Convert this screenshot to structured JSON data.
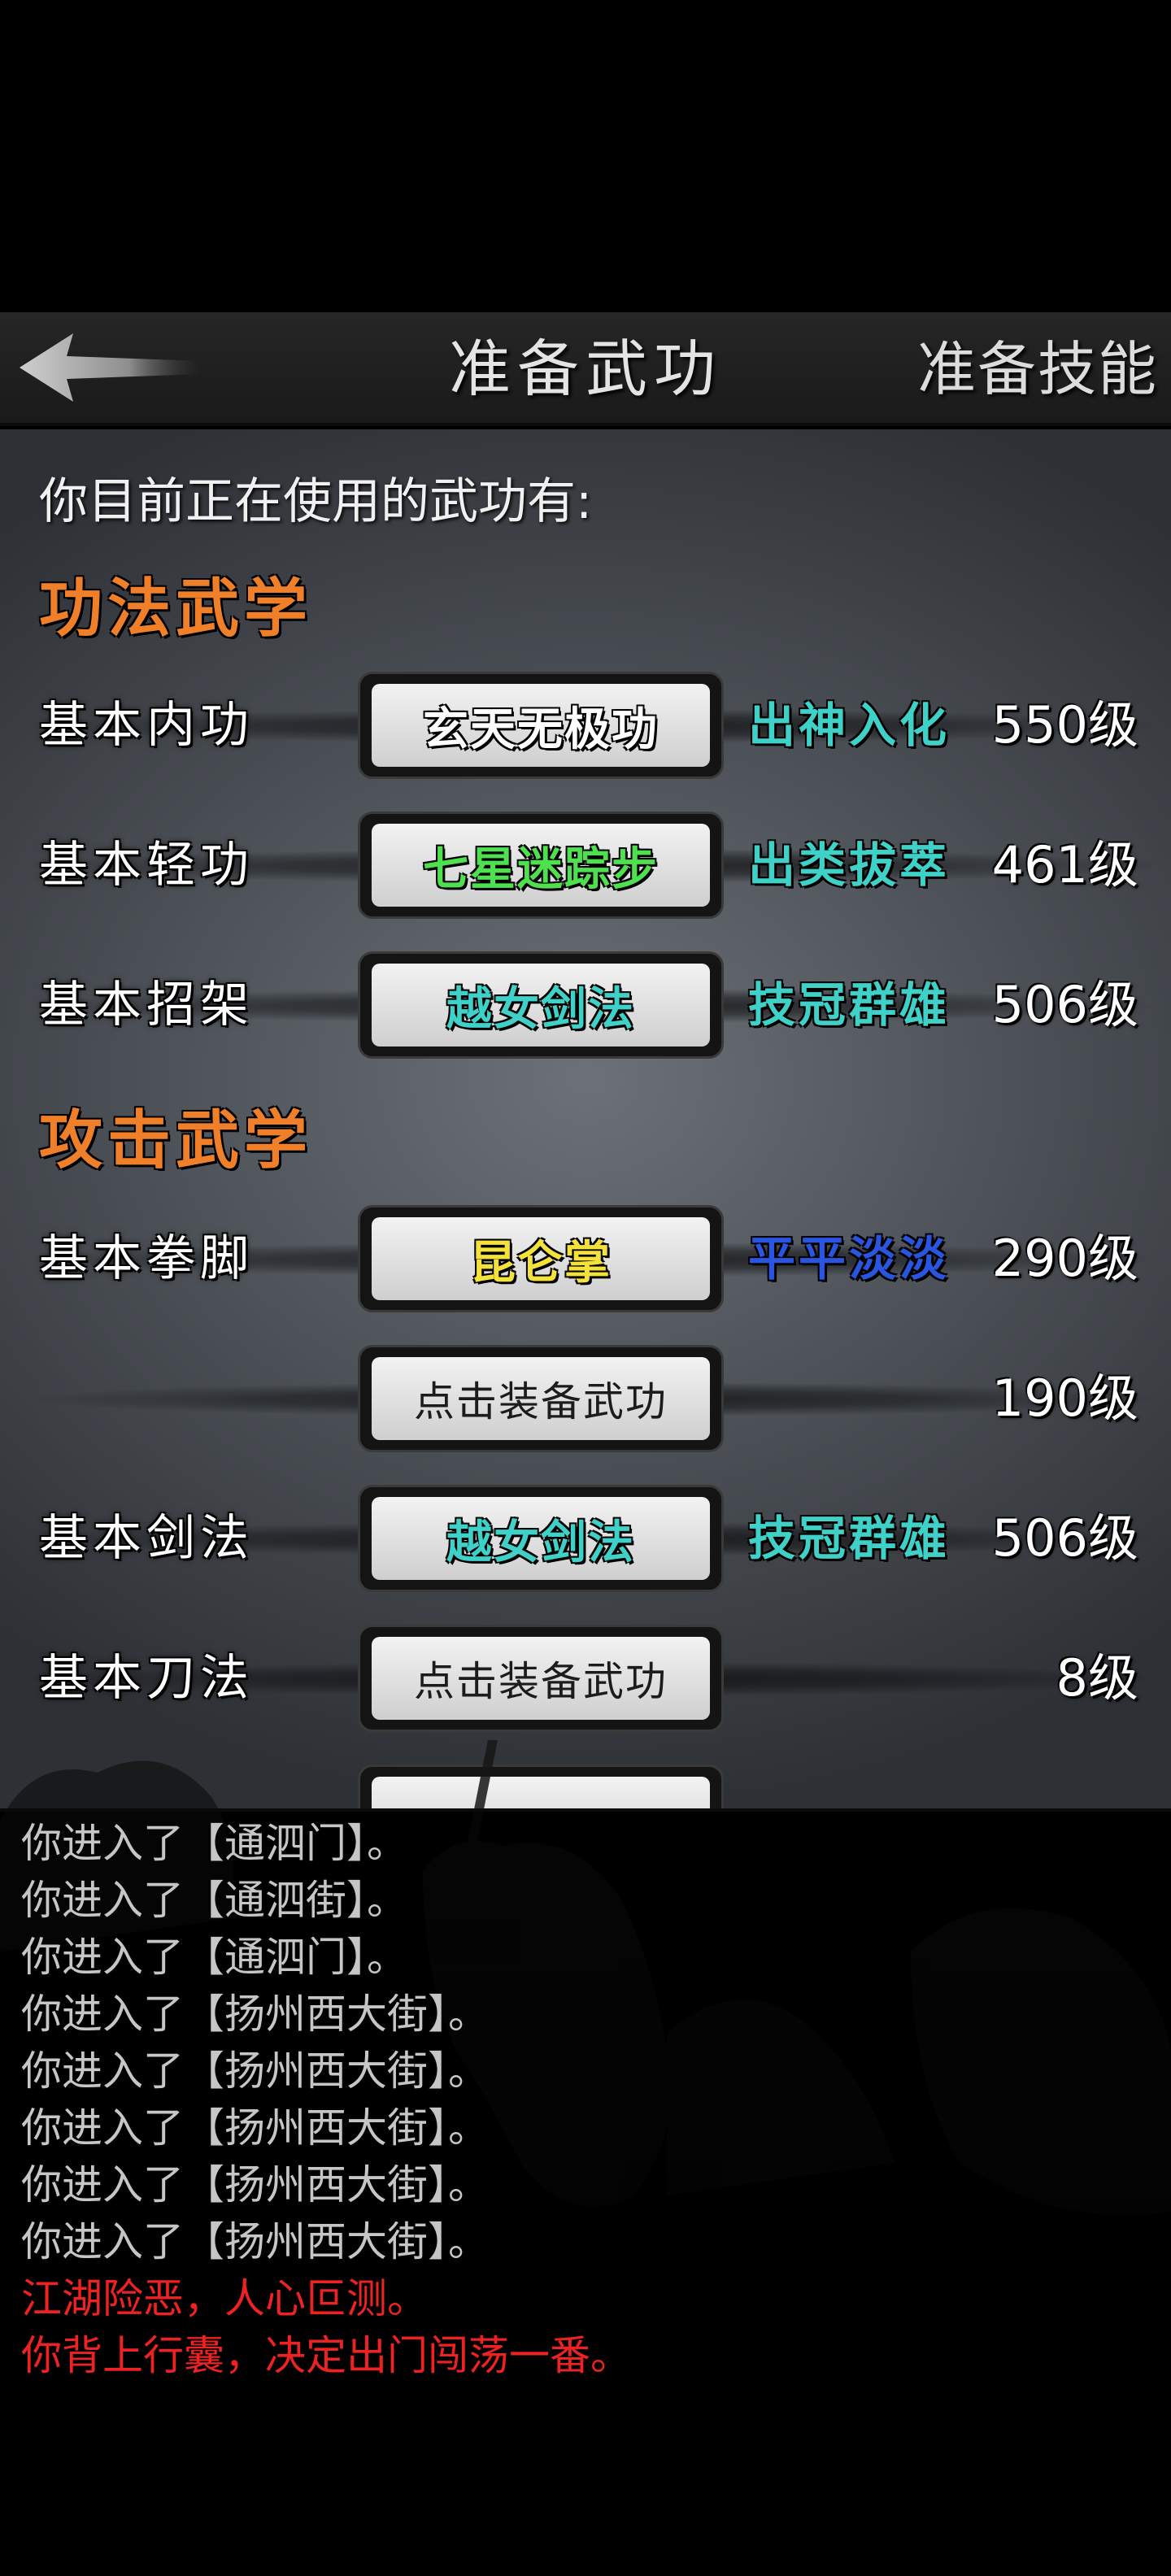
{
  "header": {
    "back_icon": "back-arrow-icon",
    "title": "准备武功",
    "right_tab": "准备技能"
  },
  "intro": "你目前正在使用的武功有:",
  "sections": {
    "gongfa": "功法武学",
    "gongji": "攻击武学"
  },
  "rows": [
    {
      "label": "基本内功",
      "equipped": "玄天无极功",
      "equipped_color": "#ffffff",
      "rank": "出神入化",
      "rank_color": "#3fd0c8",
      "level": "550级"
    },
    {
      "label": "基本轻功",
      "equipped": "七星迷踪步",
      "equipped_color": "#4ee04e",
      "rank": "出类拔萃",
      "rank_color": "#3fd0c8",
      "level": "461级"
    },
    {
      "label": "基本招架",
      "equipped": "越女剑法",
      "equipped_color": "#3fd0c8",
      "rank": "技冠群雄",
      "rank_color": "#3fd0c8",
      "level": "506级"
    },
    {
      "label": "基本拳脚",
      "equipped": "昆仑掌",
      "equipped_color": "#f4e23a",
      "rank": "平平淡淡",
      "rank_color": "#2a55e0",
      "level": "290级"
    },
    {
      "label": "",
      "equipped": "点击装备武功",
      "equipped_color": "#1c1c1c",
      "rank": "",
      "rank_color": "#3fd0c8",
      "level": "190级"
    },
    {
      "label": "基本剑法",
      "equipped": "越女剑法",
      "equipped_color": "#3fd0c8",
      "rank": "技冠群雄",
      "rank_color": "#3fd0c8",
      "level": "506级"
    },
    {
      "label": "基本刀法",
      "equipped": "点击装备武功",
      "equipped_color": "#1c1c1c",
      "rank": "",
      "rank_color": "#3fd0c8",
      "level": "8级"
    }
  ],
  "log": [
    {
      "text": "你进入了【通泗门】。",
      "color": "gray"
    },
    {
      "text": "你进入了【通泗街】。",
      "color": "gray"
    },
    {
      "text": "你进入了【通泗门】。",
      "color": "gray"
    },
    {
      "text": "你进入了【扬州西大街】。",
      "color": "gray"
    },
    {
      "text": "你进入了【扬州西大街】。",
      "color": "gray"
    },
    {
      "text": "你进入了【扬州西大街】。",
      "color": "gray"
    },
    {
      "text": "你进入了【扬州西大街】。",
      "color": "gray"
    },
    {
      "text": "你进入了【扬州西大街】。",
      "color": "gray"
    },
    {
      "text": "江湖险恶，人心叵测。",
      "color": "red"
    },
    {
      "text": "你背上行囊，决定出门闯荡一番。",
      "color": "red"
    }
  ]
}
